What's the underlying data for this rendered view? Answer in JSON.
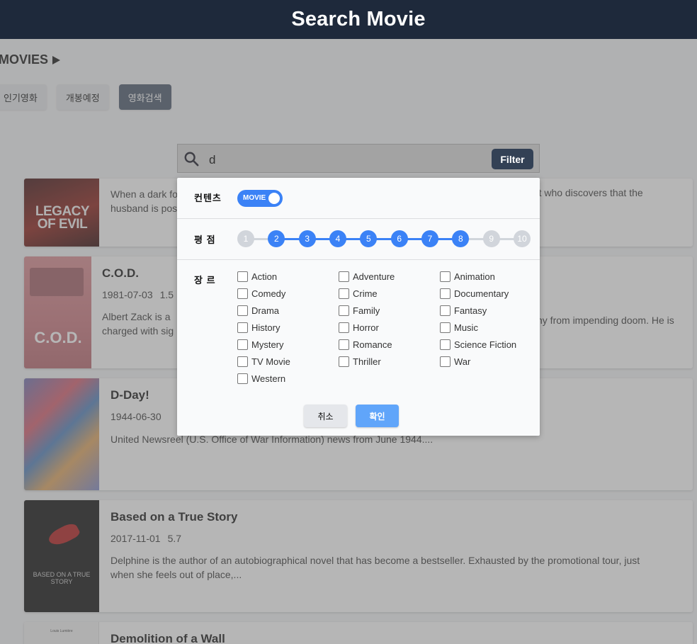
{
  "header": {
    "title": "Search Movie"
  },
  "section": {
    "title": "MOVIES"
  },
  "tabs": [
    {
      "label": "인기영화",
      "active": false
    },
    {
      "label": "개봉예정",
      "active": false
    },
    {
      "label": "영화검색",
      "active": true
    }
  ],
  "search": {
    "value": "d",
    "filter_label": "Filter"
  },
  "movies": [
    {
      "title": "",
      "date": "",
      "rating": "",
      "desc_line1": "When a dark fo",
      "desc_line1_tail": "ologist who discovers that the",
      "desc_line2": "husband is pos",
      "poster_text": "LEGACY OF EVIL"
    },
    {
      "title": "C.O.D.",
      "date": "1981-07-03",
      "rating": "1.5",
      "desc_line1": "Albert Zack is a",
      "desc_line1_tail": "ny from impending doom. He is",
      "desc_line2": "charged with sig",
      "poster_text": "C.O.D."
    },
    {
      "title": "D-Day!",
      "date": "1944-06-30",
      "rating": "",
      "desc_line1": "United Newsreel (U.S. Office of War Information) news from June 1944....",
      "desc_line1_tail": "",
      "desc_line2": "",
      "poster_text": ""
    },
    {
      "title": "Based on a True Story",
      "date": "2017-11-01",
      "rating": "5.7",
      "desc_line1": "Delphine is the author of an autobiographical novel that has become a bestseller. Exhausted by the promotional tour, just",
      "desc_line1_tail": "",
      "desc_line2": "when she feels out of place,...",
      "poster_text": "BASED ON A TRUE STORY"
    },
    {
      "title": "Demolition of a Wall",
      "date": "",
      "rating": "",
      "desc_line1": "",
      "desc_line1_tail": "",
      "desc_line2": "",
      "poster_text": "Louis Lumière"
    }
  ],
  "modal": {
    "content_label": "컨텐츠",
    "content_toggle": "MOVIE",
    "rating_label": "평 점",
    "rating_steps": [
      "1",
      "2",
      "3",
      "4",
      "5",
      "6",
      "7",
      "8",
      "9",
      "10"
    ],
    "rating_min": 2,
    "rating_max": 8,
    "genre_label": "장 르",
    "genres": [
      "Action",
      "Adventure",
      "Animation",
      "Comedy",
      "Crime",
      "Documentary",
      "Drama",
      "Family",
      "Fantasy",
      "History",
      "Horror",
      "Music",
      "Mystery",
      "Romance",
      "Science Fiction",
      "TV Movie",
      "Thriller",
      "War",
      "Western"
    ],
    "cancel_label": "취소",
    "ok_label": "확인"
  },
  "colors": {
    "header_bg": "#1e293b",
    "accent": "#3b82f6",
    "filter_btn": "#334155"
  }
}
